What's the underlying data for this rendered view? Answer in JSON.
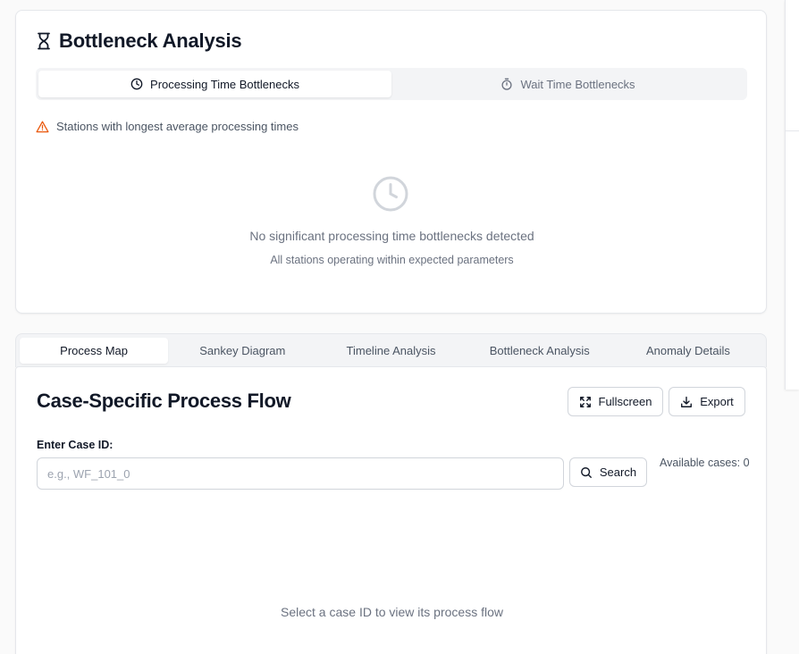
{
  "bottleneck": {
    "title": "Bottleneck Analysis",
    "title_icon": "hourglass-icon",
    "tabs": [
      {
        "label": "Processing Time Bottlenecks",
        "icon": "clock-icon",
        "active": true
      },
      {
        "label": "Wait Time Bottlenecks",
        "icon": "stopwatch-icon",
        "active": false
      }
    ],
    "warning_text": "Stations with longest average processing times",
    "empty_message": "No significant processing time bottlenecks detected",
    "empty_subtext": "All stations operating within expected parameters"
  },
  "main_tabs": [
    {
      "label": "Process Map",
      "active": true
    },
    {
      "label": "Sankey Diagram",
      "active": false
    },
    {
      "label": "Timeline Analysis",
      "active": false
    },
    {
      "label": "Bottleneck Analysis",
      "active": false
    },
    {
      "label": "Anomaly Details",
      "active": false
    }
  ],
  "process_flow": {
    "title": "Case-Specific Process Flow",
    "fullscreen_label": "Fullscreen",
    "export_label": "Export",
    "case_label": "Enter Case ID:",
    "case_value": "",
    "case_placeholder": "e.g., WF_101_0",
    "search_label": "Search",
    "available_cases": "Available cases: 0",
    "empty_message": "Select a case ID to view its process flow"
  },
  "colors": {
    "warning": "#ea580c",
    "muted": "#6b7280",
    "border": "#e5e7eb"
  }
}
